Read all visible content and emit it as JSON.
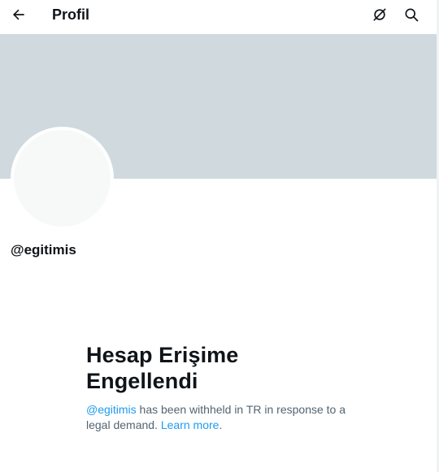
{
  "header": {
    "title": "Profil",
    "back_icon": "arrow-left-icon",
    "grok_icon": "grok-icon",
    "search_icon": "search-icon"
  },
  "profile": {
    "handle": "@egitimis",
    "banner_color": "#cfd9de",
    "avatar_color": "#f7f9f9"
  },
  "notice": {
    "title": "Hesap Erişime Engellendi",
    "handle_link": "@egitimis",
    "message": " has been withheld in TR in response to a legal demand. ",
    "learn_more": "Learn more",
    "end": ".",
    "link_color": "#1d9bf0"
  }
}
